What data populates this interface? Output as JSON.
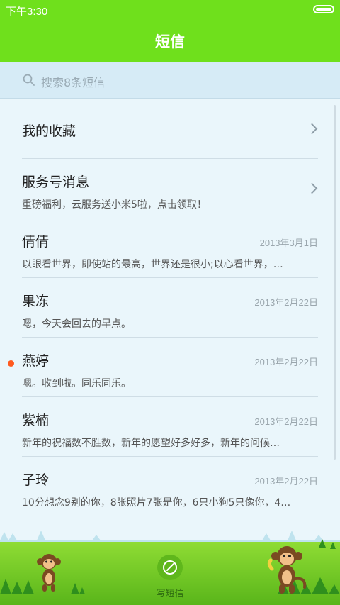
{
  "status_bar": {
    "time": "下午3:30",
    "battery_icon": "battery-icon"
  },
  "header": {
    "title": "短信"
  },
  "search": {
    "placeholder": "搜索8条短信",
    "icon": "search-icon"
  },
  "favorites": {
    "label": "我的收藏",
    "icon": "chevron-right-icon"
  },
  "service_messages": {
    "title": "服务号消息",
    "subtitle": "重磅福利，云服务送小米5啦，点击领取！",
    "icon": "chevron-right-icon"
  },
  "conversations": [
    {
      "name": "倩倩",
      "date": "2013年3月1日",
      "preview": "以眼看世界，即使站的最高，世界还是很小;以心看世界，…",
      "unread": false
    },
    {
      "name": "果冻",
      "date": "2013年2月22日",
      "preview": "嗯，今天会回去的早点。",
      "unread": false
    },
    {
      "name": "燕婷",
      "date": "2013年2月22日",
      "preview": "嗯。收到啦。同乐同乐。",
      "unread": true
    },
    {
      "name": "紫楠",
      "date": "2013年2月22日",
      "preview": "新年的祝福数不胜数，新年的愿望好多好多，新年的问候…",
      "unread": false
    },
    {
      "name": "子玲",
      "date": "2013年2月22日",
      "preview": "10分想念9别的你，8张照片7张是你，6只小狗5只像你，4…",
      "unread": false
    }
  ],
  "footer": {
    "compose_label": "写短信",
    "compose_icon": "compose-icon"
  },
  "colors": {
    "accent_green": "#6fe01c",
    "unread_dot": "#ff5a1f",
    "list_background": "#eaf6fb"
  }
}
